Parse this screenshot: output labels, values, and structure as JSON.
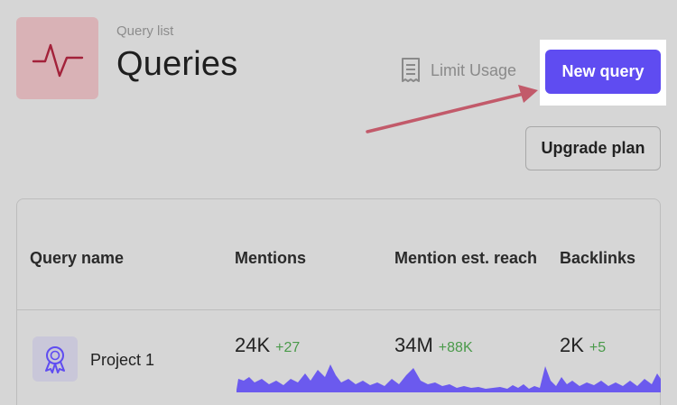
{
  "header": {
    "kicker": "Query list",
    "title": "Queries",
    "limit_label": "Limit Usage",
    "new_query_label": "New query",
    "upgrade_label": "Upgrade plan"
  },
  "icons": {
    "logo": "pulse-icon",
    "limit": "receipt-icon",
    "row": "award-ribbon-icon"
  },
  "colors": {
    "accent": "#5f4cf1",
    "positive": "#4a9a4a",
    "logo_bg": "#d9b2b6",
    "logo_stroke": "#a3223a",
    "annotation_arrow": "#c25a6a"
  },
  "table": {
    "columns": [
      "Query name",
      "Mentions",
      "Mention est. reach",
      "Backlinks"
    ],
    "rows": [
      {
        "name": "Project 1",
        "mentions": {
          "value": "24K",
          "delta": "+27"
        },
        "reach": {
          "value": "34M",
          "delta": "+88K"
        },
        "backlinks": {
          "value": "2K",
          "delta": "+5"
        }
      }
    ]
  }
}
